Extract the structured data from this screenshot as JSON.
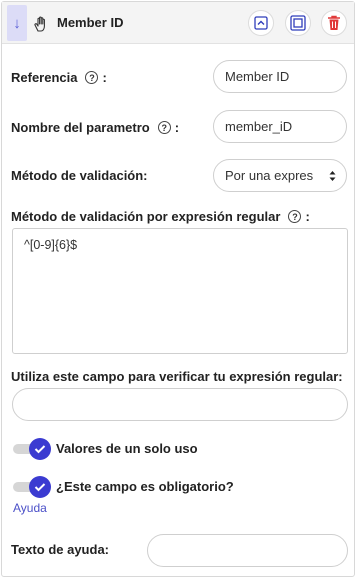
{
  "header": {
    "title": "Member ID",
    "collapse_icon": "arrow-down-icon",
    "drag_icon": "drag-hand-icon",
    "buttons": [
      "collapse-up-icon",
      "duplicate-icon",
      "trash-icon"
    ],
    "accent": "#5b5fd6",
    "danger": "#e03a3a"
  },
  "fields": {
    "referencia": {
      "label": "Referencia",
      "value": "Member ID"
    },
    "nombre_parametro": {
      "label": "Nombre del parametro",
      "value": "member_iD"
    },
    "metodo_validacion": {
      "label": "Método de validación:",
      "value": "Por una expres"
    },
    "regex": {
      "label": "Método de validación por expresión regular",
      "value": "^[0-9]{6}$"
    },
    "verify": {
      "label": "Utiliza este campo para verificar tu expresión regular:",
      "value": ""
    },
    "help_text": {
      "label": "Texto de ayuda:",
      "value": ""
    }
  },
  "colon": ":",
  "help_glyph": "?",
  "toggles": {
    "single_use": {
      "label": "Valores de un solo uso",
      "checked": true
    },
    "required": {
      "label": "¿Este campo es obligatorio?",
      "checked": true
    }
  },
  "help_link": "Ayuda",
  "toggle_color": "#3b3bd1"
}
